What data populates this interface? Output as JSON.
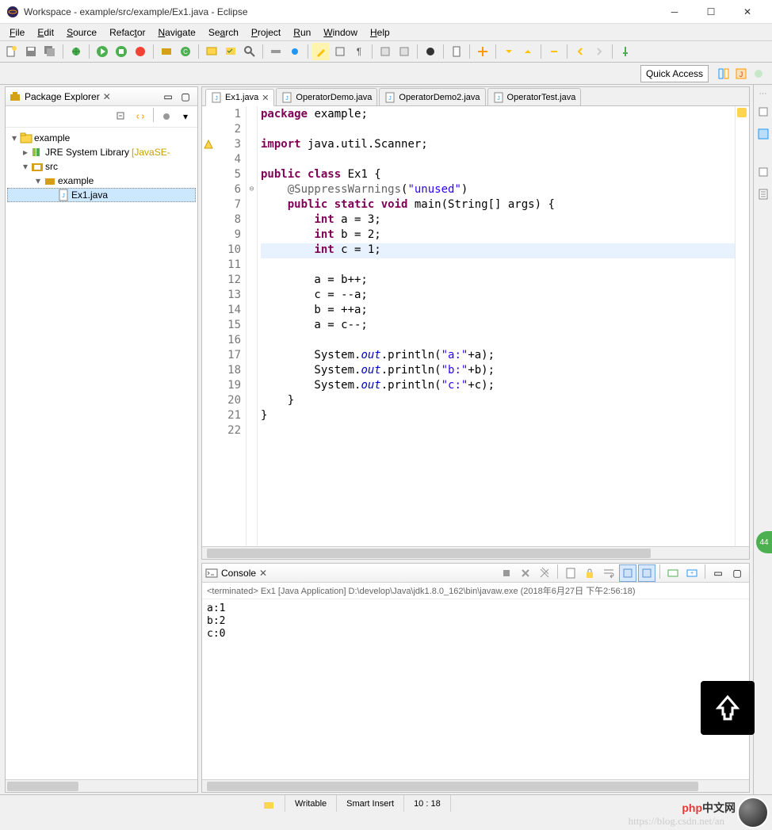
{
  "window": {
    "title": "Workspace - example/src/example/Ex1.java - Eclipse"
  },
  "menu": {
    "file": "File",
    "edit": "Edit",
    "source": "Source",
    "refactor": "Refactor",
    "navigate": "Navigate",
    "search": "Search",
    "project": "Project",
    "run": "Run",
    "window": "Window",
    "help": "Help"
  },
  "quick_access": "Quick Access",
  "package_explorer": {
    "title": "Package Explorer",
    "tree": {
      "project": "example",
      "jre": "JRE System Library",
      "jre_suffix": "[JavaSE-",
      "src": "src",
      "pkg": "example",
      "file": "Ex1.java"
    }
  },
  "editor_tabs": [
    {
      "label": "Ex1.java",
      "active": true,
      "closeable": true
    },
    {
      "label": "OperatorDemo.java",
      "active": false
    },
    {
      "label": "OperatorDemo2.java",
      "active": false
    },
    {
      "label": "OperatorTest.java",
      "active": false
    }
  ],
  "code": {
    "lines": [
      {
        "n": 1,
        "html": "<span class='kw'>package</span> example;"
      },
      {
        "n": 2,
        "html": ""
      },
      {
        "n": 3,
        "html": "<span class='kw'>import</span> java.util.Scanner;",
        "marker": "warn"
      },
      {
        "n": 4,
        "html": ""
      },
      {
        "n": 5,
        "html": "<span class='kw'>public class</span> Ex1 {"
      },
      {
        "n": 6,
        "html": "    <span class='ann'>@SuppressWarnings</span>(<span class='str'>\"unused\"</span>)",
        "fold": "⊖"
      },
      {
        "n": 7,
        "html": "    <span class='kw'>public static void</span> main(String[] args) {"
      },
      {
        "n": 8,
        "html": "        <span class='kw'>int</span> a = 3;"
      },
      {
        "n": 9,
        "html": "        <span class='kw'>int</span> b = 2;"
      },
      {
        "n": 10,
        "html": "        <span class='kw'>int</span> c = 1;",
        "hl": true
      },
      {
        "n": 11,
        "html": ""
      },
      {
        "n": 12,
        "html": "        a = b++;"
      },
      {
        "n": 13,
        "html": "        c = --a;"
      },
      {
        "n": 14,
        "html": "        b = ++a;"
      },
      {
        "n": 15,
        "html": "        a = c--;"
      },
      {
        "n": 16,
        "html": ""
      },
      {
        "n": 17,
        "html": "        System.<span class='static-it'>out</span>.println(<span class='str'>\"a:\"</span>+a);"
      },
      {
        "n": 18,
        "html": "        System.<span class='static-it'>out</span>.println(<span class='str'>\"b:\"</span>+b);"
      },
      {
        "n": 19,
        "html": "        System.<span class='static-it'>out</span>.println(<span class='str'>\"c:\"</span>+c);"
      },
      {
        "n": 20,
        "html": "    }"
      },
      {
        "n": 21,
        "html": "}"
      },
      {
        "n": 22,
        "html": ""
      }
    ]
  },
  "console": {
    "title": "Console",
    "sub": "<terminated> Ex1 [Java Application] D:\\develop\\Java\\jdk1.8.0_162\\bin\\javaw.exe (2018年6月27日 下午2:56:18)",
    "output": [
      "a:1",
      "b:2",
      "c:0"
    ]
  },
  "status": {
    "writable": "Writable",
    "insert": "Smart Insert",
    "pos": "10 : 18"
  },
  "watermark": "https://blog.csdn.net/an",
  "php_badge": "php中文网",
  "badge44": "44"
}
